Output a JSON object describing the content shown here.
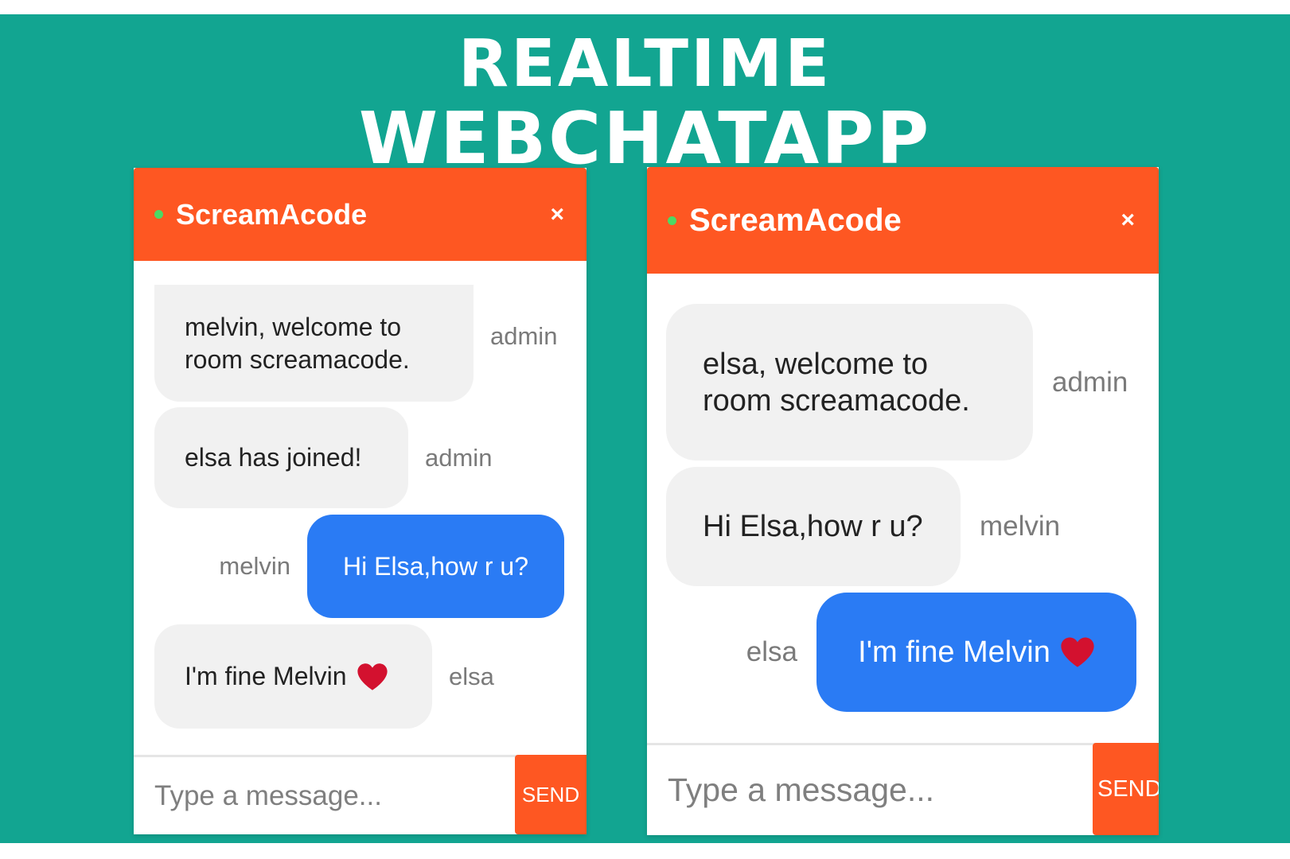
{
  "headline": {
    "line1": "REALTIME",
    "line2": "WEBCHATAPP"
  },
  "colors": {
    "background": "#12a591",
    "header": "#fe5722",
    "send_button": "#fe5722",
    "outgoing_bubble": "#2a7bf4",
    "incoming_bubble": "#f1f1f1",
    "online_dot": "#4cd964",
    "heart": "#d3112f"
  },
  "left_chat": {
    "room_name": "ScreamAcode",
    "close_icon": "close-icon",
    "close_label": "×",
    "messages": [
      {
        "text": "melvin, welcome to\nroom screamacode.",
        "sender": "admin",
        "direction": "incoming"
      },
      {
        "text": "elsa has joined!",
        "sender": "admin",
        "direction": "incoming"
      },
      {
        "text": "Hi Elsa,how r u?",
        "sender": "melvin",
        "direction": "outgoing"
      },
      {
        "text": "I'm fine Melvin",
        "sender": "elsa",
        "direction": "incoming",
        "icon": "heart-icon"
      }
    ],
    "input_placeholder": "Type a message...",
    "send_label": "SEND"
  },
  "right_chat": {
    "room_name": "ScreamAcode",
    "close_icon": "close-icon",
    "close_label": "×",
    "messages": [
      {
        "text": "elsa, welcome to\nroom screamacode.",
        "sender": "admin",
        "direction": "incoming"
      },
      {
        "text": "Hi Elsa,how r u?",
        "sender": "melvin",
        "direction": "incoming"
      },
      {
        "text": "I'm fine Melvin",
        "sender": "elsa",
        "direction": "outgoing",
        "icon": "heart-icon"
      }
    ],
    "input_placeholder": "Type a message...",
    "send_label": "SEND"
  }
}
